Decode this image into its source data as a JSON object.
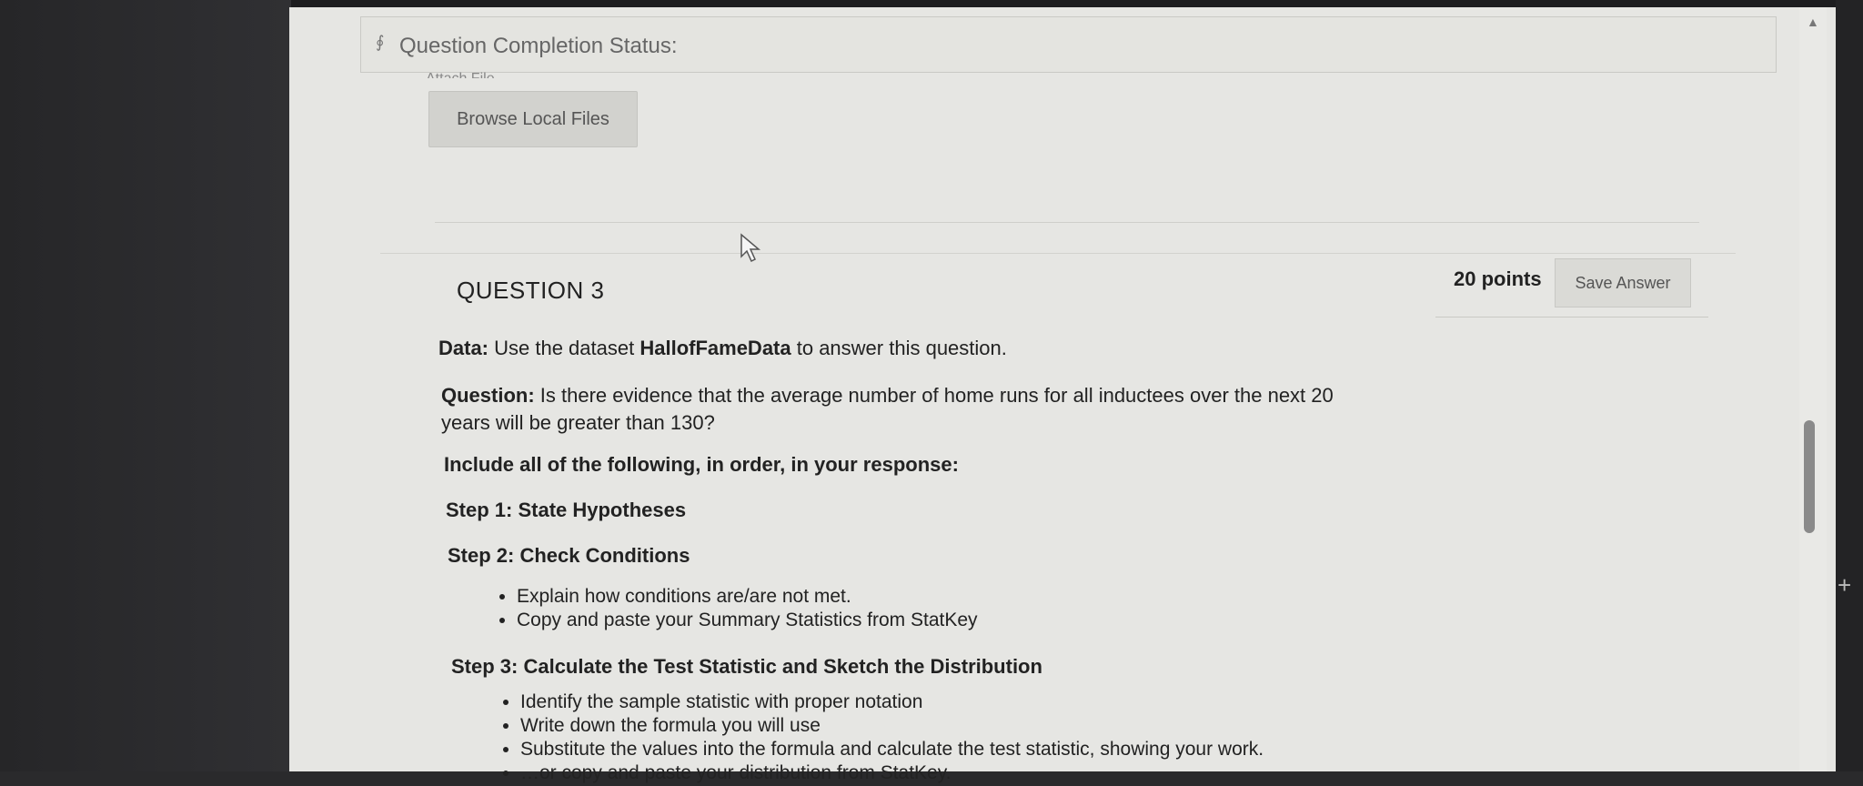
{
  "completion_status": {
    "label": "Question Completion Status:"
  },
  "attach": {
    "label": "Attach File",
    "browse_label": "Browse Local Files"
  },
  "question": {
    "title": "QUESTION 3",
    "points": "20 points",
    "save_label": "Save Answer",
    "data_prefix": "Data:",
    "data_text_1": " Use the dataset ",
    "dataset_name": "HallofFameData",
    "data_text_2": " to answer this question.",
    "question_prefix": "Question:",
    "question_line1": " Is there evidence that the average number of home runs for all inductees over the next 20",
    "question_line2": "years will be greater than 130?",
    "include_instruction": "Include all of the following, in order, in your response:",
    "step1": "Step 1: State Hypotheses",
    "step2": "Step 2: Check Conditions",
    "step2_items": [
      "Explain how conditions are/are not met.",
      "Copy and paste your Summary Statistics from StatKey"
    ],
    "step3": "Step 3:  Calculate the Test Statistic and Sketch the Distribution",
    "step3_items": [
      "Identify the sample statistic with proper notation",
      "Write down the formula you will use",
      "Substitute the values into the formula and calculate the test statistic, showing your work.",
      "…or copy and paste your distribution from StatKey."
    ]
  }
}
